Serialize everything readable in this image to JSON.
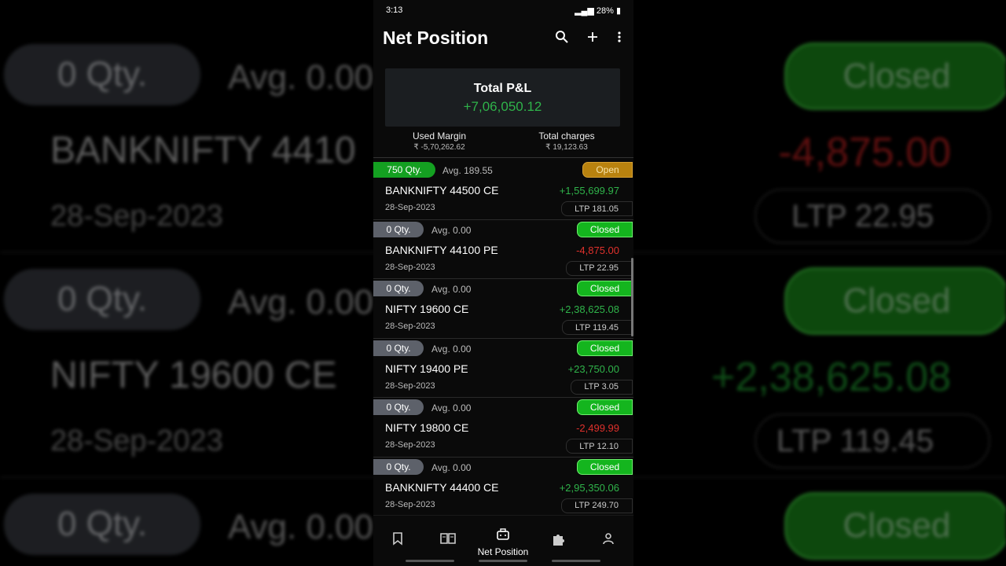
{
  "status_bar": {
    "time": "3:13",
    "battery": "28%"
  },
  "app": {
    "title": "Net Position"
  },
  "summary": {
    "pnl_label": "Total P&L",
    "pnl_value": "+7,06,050.12",
    "used_margin_label": "Used Margin",
    "used_margin_value": "₹ -5,70,262.62",
    "charges_label": "Total charges",
    "charges_value": "₹ 19,123.63"
  },
  "positions": [
    {
      "qty": "750 Qty.",
      "avg": "Avg. 189.55",
      "status": "Open",
      "name": "BANKNIFTY 44500 CE",
      "pnl": "+1,55,699.97",
      "date": "28-Sep-2023",
      "ltp": "LTP 181.05"
    },
    {
      "qty": "0 Qty.",
      "avg": "Avg. 0.00",
      "status": "Closed",
      "name": "BANKNIFTY 44100 PE",
      "pnl": "-4,875.00",
      "date": "28-Sep-2023",
      "ltp": "LTP 22.95"
    },
    {
      "qty": "0 Qty.",
      "avg": "Avg. 0.00",
      "status": "Closed",
      "name": "NIFTY 19600 CE",
      "pnl": "+2,38,625.08",
      "date": "28-Sep-2023",
      "ltp": "LTP 119.45"
    },
    {
      "qty": "0 Qty.",
      "avg": "Avg. 0.00",
      "status": "Closed",
      "name": "NIFTY 19400 PE",
      "pnl": "+23,750.00",
      "date": "28-Sep-2023",
      "ltp": "LTP 3.05"
    },
    {
      "qty": "0 Qty.",
      "avg": "Avg. 0.00",
      "status": "Closed",
      "name": "NIFTY 19800 CE",
      "pnl": "-2,499.99",
      "date": "28-Sep-2023",
      "ltp": "LTP 12.10"
    },
    {
      "qty": "0 Qty.",
      "avg": "Avg. 0.00",
      "status": "Closed",
      "name": "BANKNIFTY 44400 CE",
      "pnl": "+2,95,350.06",
      "date": "28-Sep-2023",
      "ltp": "LTP 249.70"
    }
  ],
  "bottom_nav": {
    "items": [
      {
        "icon": "bookmark-icon"
      },
      {
        "icon": "book-icon"
      },
      {
        "icon": "briefcase-icon",
        "label": "Net Position"
      },
      {
        "icon": "puzzle-icon"
      },
      {
        "icon": "person-icon"
      }
    ]
  },
  "background": {
    "qty_label": "0 Qty.",
    "avg_label": "Avg. 0.00",
    "closed_label": "Closed",
    "name_1": "BANKNIFTY 4410",
    "name_2": "NIFTY 19600 CE",
    "date_label": "28-Sep-2023",
    "pnl_1": "-4,875.00",
    "pnl_2": "+2,38,625.08",
    "ltp_1": "LTP 22.95",
    "ltp_2": "LTP 119.45"
  },
  "colors": {
    "positive": "#2fb34a",
    "negative": "#e0312c",
    "closed": "#14b51e",
    "open": "#b8820f"
  }
}
